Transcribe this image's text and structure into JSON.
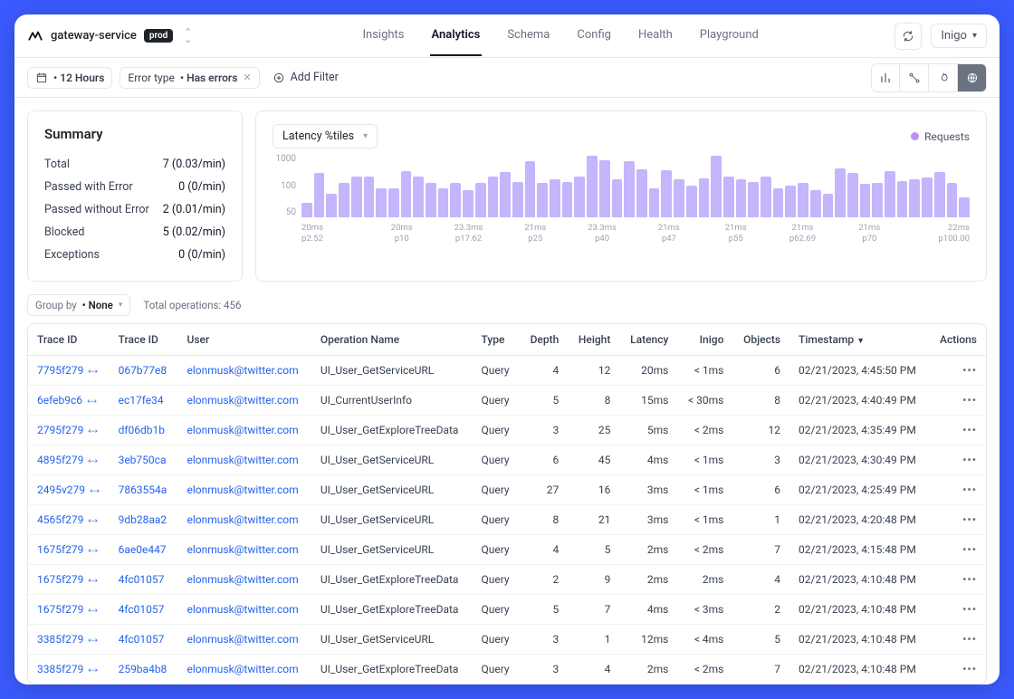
{
  "header": {
    "service_name": "gateway-service",
    "env_badge": "prod",
    "tabs": [
      "Insights",
      "Analytics",
      "Schema",
      "Config",
      "Health",
      "Playground"
    ],
    "active_tab_index": 1,
    "account_label": "Inigo"
  },
  "filterbar": {
    "time_chip_label": "• 12 Hours",
    "error_chip_prefix": "Error type",
    "error_chip_value": "• Has errors",
    "add_filter_label": "Add Filter"
  },
  "summary": {
    "title": "Summary",
    "rows": [
      {
        "label": "Total",
        "value": "7 (0.03/min)"
      },
      {
        "label": "Passed with Error",
        "value": "0 (0/min)"
      },
      {
        "label": "Passed without Error",
        "value": "2 (0.01/min)"
      },
      {
        "label": "Blocked",
        "value": "5 (0.02/min)"
      },
      {
        "label": "Exceptions",
        "value": "0 (0/min)"
      }
    ]
  },
  "chart": {
    "dropdown": "Latency %tiles",
    "legend": "Requests"
  },
  "chart_data": {
    "type": "bar",
    "title": "",
    "ylabel": "",
    "ylim": [
      50,
      1000
    ],
    "yticks": [
      1000,
      100,
      50
    ],
    "bars": [
      100,
      400,
      150,
      250,
      350,
      350,
      200,
      200,
      450,
      350,
      250,
      200,
      250,
      180,
      250,
      350,
      430,
      270,
      700,
      250,
      300,
      260,
      350,
      920,
      740,
      300,
      720,
      490,
      200,
      460,
      300,
      220,
      310,
      930,
      340,
      300,
      260,
      340,
      200,
      220,
      250,
      180,
      150,
      500,
      400,
      240,
      250,
      450,
      280,
      300,
      330,
      430,
      250,
      130
    ],
    "xaxis_groups": [
      {
        "top": "20ms",
        "bottom": "p2.52"
      },
      {
        "top": "20ms",
        "bottom": "p10"
      },
      {
        "top": "23.3ms",
        "bottom": "p17.62"
      },
      {
        "top": "21ms",
        "bottom": "p25"
      },
      {
        "top": "23.3ms",
        "bottom": "p40"
      },
      {
        "top": "21ms",
        "bottom": "p47"
      },
      {
        "top": "21ms",
        "bottom": "p55"
      },
      {
        "top": "21ms",
        "bottom": "p62.69"
      },
      {
        "top": "21ms",
        "bottom": "p70"
      },
      {
        "top": "22ms",
        "bottom": "p100.00"
      }
    ]
  },
  "grouping": {
    "group_by_prefix": "Group by",
    "group_by_value": "• None",
    "total_operations": "Total operations: 456"
  },
  "table": {
    "columns": [
      "Trace ID",
      "Trace ID",
      "User",
      "Operation Name",
      "Type",
      "Depth",
      "Height",
      "Latency",
      "Inigo",
      "Objects",
      "Timestamp",
      "Actions"
    ],
    "sort_column_index": 10,
    "rows": [
      {
        "trace_a": "7795f279",
        "trace_b": "067b77e8",
        "user": "elonmusk@twitter.com",
        "op": "UI_User_GetServiceURL",
        "type": "Query",
        "depth": "4",
        "height": "12",
        "latency": "20ms",
        "inigo": "< 1ms",
        "objects": "6",
        "timestamp": "02/21/2023, 4:45:50 PM"
      },
      {
        "trace_a": "6efeb9c6",
        "trace_b": "ec17fe34",
        "user": "elonmusk@twitter.com",
        "op": "UI_CurrentUserInfo",
        "type": "Query",
        "depth": "5",
        "height": "8",
        "latency": "15ms",
        "inigo": "< 30ms",
        "objects": "8",
        "timestamp": "02/21/2023, 4:40:49 PM"
      },
      {
        "trace_a": "2795f279",
        "trace_b": "df06db1b",
        "user": "elonmusk@twitter.com",
        "op": "UI_User_GetExploreTreeData",
        "type": "Query",
        "depth": "3",
        "height": "25",
        "latency": "5ms",
        "inigo": "< 2ms",
        "objects": "12",
        "timestamp": "02/21/2023, 4:35:49 PM"
      },
      {
        "trace_a": "4895f279",
        "trace_b": "3eb750ca",
        "user": "elonmusk@twitter.com",
        "op": "UI_User_GetServiceURL",
        "type": "Query",
        "depth": "6",
        "height": "45",
        "latency": "4ms",
        "inigo": "< 1ms",
        "objects": "3",
        "timestamp": "02/21/2023, 4:30:49 PM"
      },
      {
        "trace_a": "2495v279",
        "trace_b": "7863554a",
        "user": "elonmusk@twitter.com",
        "op": "UI_User_GetServiceURL",
        "type": "Query",
        "depth": "27",
        "height": "16",
        "latency": "3ms",
        "inigo": "< 1ms",
        "objects": "6",
        "timestamp": "02/21/2023, 4:25:49 PM"
      },
      {
        "trace_a": "4565f279",
        "trace_b": "9db28aa2",
        "user": "elonmusk@twitter.com",
        "op": "UI_User_GetServiceURL",
        "type": "Query",
        "depth": "8",
        "height": "21",
        "latency": "3ms",
        "inigo": "< 1ms",
        "objects": "1",
        "timestamp": "02/21/2023, 4:20:48 PM"
      },
      {
        "trace_a": "1675f279",
        "trace_b": "6ae0e447",
        "user": "elonmusk@twitter.com",
        "op": "UI_User_GetServiceURL",
        "type": "Query",
        "depth": "4",
        "height": "5",
        "latency": "2ms",
        "inigo": "< 2ms",
        "objects": "7",
        "timestamp": "02/21/2023, 4:15:48 PM"
      },
      {
        "trace_a": "1675f279",
        "trace_b": "4fc01057",
        "user": "elonmusk@twitter.com",
        "op": "UI_User_GetExploreTreeData",
        "type": "Query",
        "depth": "2",
        "height": "9",
        "latency": "2ms",
        "inigo": "2ms",
        "objects": "4",
        "timestamp": "02/21/2023, 4:10:48 PM"
      },
      {
        "trace_a": "1675f279",
        "trace_b": "4fc01057",
        "user": "elonmusk@twitter.com",
        "op": "UI_User_GetExploreTreeData",
        "type": "Query",
        "depth": "5",
        "height": "7",
        "latency": "4ms",
        "inigo": "< 3ms",
        "objects": "2",
        "timestamp": "02/21/2023, 4:10:48 PM"
      },
      {
        "trace_a": "3385f279",
        "trace_b": "4fc01057",
        "user": "elonmusk@twitter.com",
        "op": "UI_User_GetServiceURL",
        "type": "Query",
        "depth": "3",
        "height": "1",
        "latency": "12ms",
        "inigo": "< 4ms",
        "objects": "5",
        "timestamp": "02/21/2023, 4:10:48 PM"
      },
      {
        "trace_a": "3385f279",
        "trace_b": "259ba4b8",
        "user": "elonmusk@twitter.com",
        "op": "UI_User_GetExploreTreeData",
        "type": "Query",
        "depth": "3",
        "height": "4",
        "latency": "2ms",
        "inigo": "< 2ms",
        "objects": "7",
        "timestamp": "02/21/2023, 4:10:48 PM"
      }
    ]
  }
}
